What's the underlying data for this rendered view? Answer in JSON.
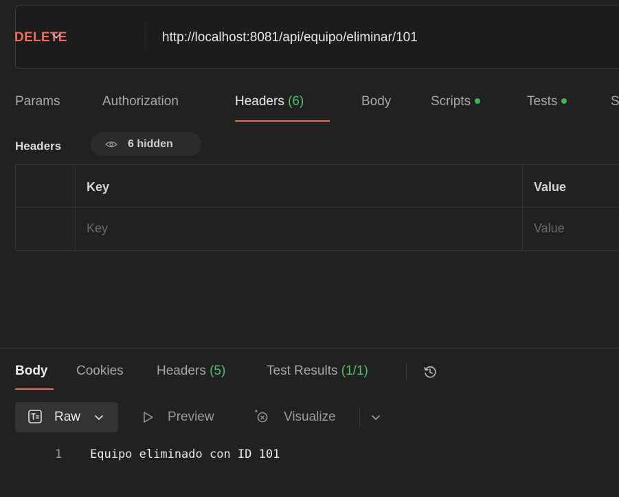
{
  "request": {
    "method": "DELETE",
    "url": "http://localhost:8081/api/equipo/eliminar/101"
  },
  "request_tabs": [
    {
      "label": "Params"
    },
    {
      "label": "Authorization"
    },
    {
      "label": "Headers",
      "count": "(6)",
      "active": true
    },
    {
      "label": "Body"
    },
    {
      "label": "Scripts",
      "indicator": "green-dot"
    },
    {
      "label": "Tests",
      "indicator": "green-dot"
    },
    {
      "label": "S"
    }
  ],
  "headers_section": {
    "title": "Headers",
    "hidden_label": "6 hidden",
    "columns": [
      "Key",
      "Value"
    ],
    "placeholder_row": {
      "key": "Key",
      "value": "Value"
    }
  },
  "response_tabs": [
    {
      "label": "Body",
      "active": true
    },
    {
      "label": "Cookies"
    },
    {
      "label": "Headers",
      "count": "(5)"
    },
    {
      "label": "Test Results",
      "count": "(1/1)"
    }
  ],
  "response_toolbar": {
    "raw_label": "Raw",
    "preview_label": "Preview",
    "visualize_label": "Visualize"
  },
  "response_body": {
    "lines": [
      {
        "number": "1",
        "text": "Equipo eliminado con ID 101"
      }
    ]
  },
  "colors": {
    "background": "#212121",
    "method_delete": "#f06b5a",
    "active_underline": "#f06b5a",
    "count_green": "#4fbf6f",
    "status_dot": "#2fbf4f"
  },
  "icons": [
    "chevron-down-icon",
    "eye-icon",
    "history-icon",
    "text-format-icon",
    "play-outline-icon",
    "visualize-sparkle-icon"
  ]
}
